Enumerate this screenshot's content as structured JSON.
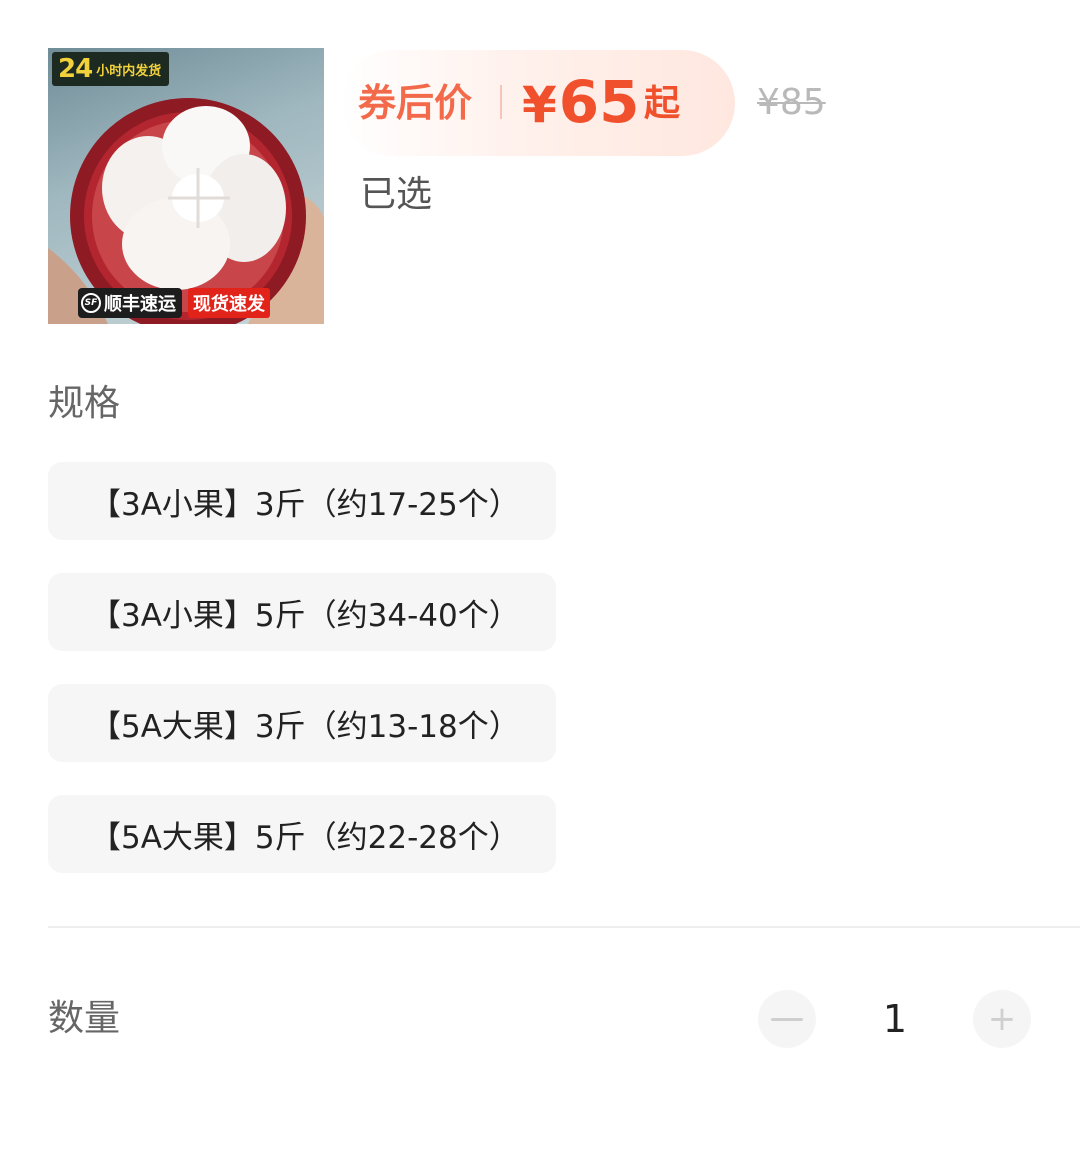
{
  "product": {
    "image": {
      "badge_top_number": "24",
      "badge_top_text": "小时内发货",
      "badge_sf_text": "顺丰速运",
      "badge_stock_text": "现货速发"
    }
  },
  "price": {
    "coupon_label": "券后价",
    "currency": "¥",
    "amount": "65",
    "suffix": "起",
    "original": "¥85"
  },
  "selected": {
    "label": "已选"
  },
  "spec": {
    "title": "规格",
    "options": [
      "【3A小果】3斤（约17-25个）",
      "【3A小果】5斤（约34-40个）",
      "【5A大果】3斤（约13-18个）",
      "【5A大果】5斤（约22-28个）"
    ]
  },
  "quantity": {
    "title": "数量",
    "value": "1",
    "minus_icon": "minus-icon",
    "plus_icon": "plus-icon",
    "plus_glyph": "+"
  },
  "colors": {
    "accent": "#f0502c",
    "coupon": "#f36a4a",
    "option_bg": "#f6f6f6"
  }
}
